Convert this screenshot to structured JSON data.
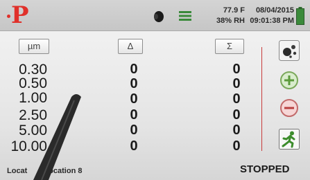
{
  "header": {
    "logo_char": "P",
    "temperature": "77.9 F",
    "humidity": "38% RH",
    "date": "08/04/2015",
    "time": "09:01:38 PM",
    "icons": [
      "speaker-icon",
      "menu-icon",
      "battery-icon"
    ]
  },
  "table": {
    "columns": {
      "size": "µm",
      "delta": "Δ",
      "sum": "Σ"
    },
    "rows": [
      {
        "size": "0.30",
        "delta": "0",
        "sum": "0"
      },
      {
        "size": "0.50",
        "delta": "0",
        "sum": "0"
      },
      {
        "size": "1.00",
        "delta": "0",
        "sum": "0"
      },
      {
        "size": "2.50",
        "delta": "0",
        "sum": "0"
      },
      {
        "size": "5.00",
        "delta": "0",
        "sum": "0"
      },
      {
        "size": "10.00",
        "delta": "0",
        "sum": "0"
      }
    ]
  },
  "sidebar": {
    "buttons": [
      "particles-icon",
      "zoom-in-icon",
      "zoom-out-icon",
      "run-icon"
    ]
  },
  "status": {
    "location_prefix": "Locat",
    "location": "Location 8",
    "state": "STOPPED"
  },
  "colors": {
    "accent_red": "#e0302a",
    "battery_green": "#3a8a3a",
    "run_green": "#3c8c2c"
  }
}
